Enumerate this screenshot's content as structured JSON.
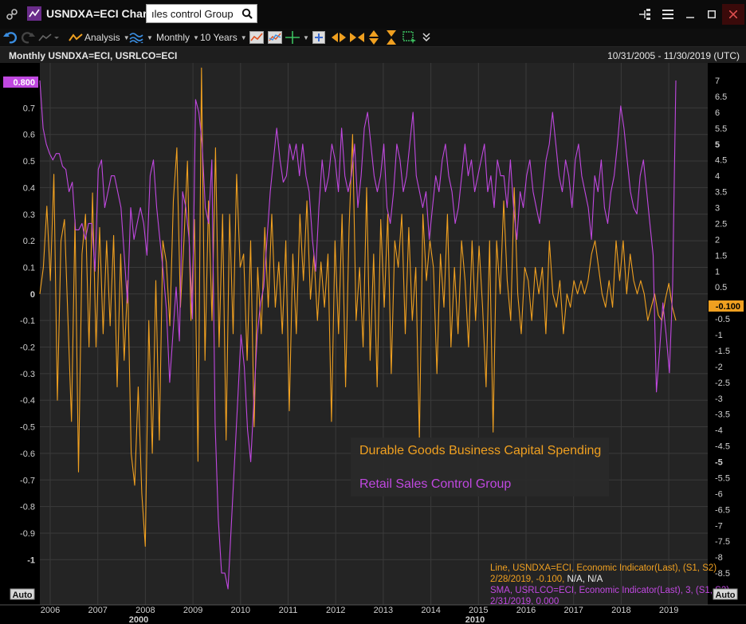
{
  "app": {
    "title": "USNDXA=ECI Chart",
    "search_value": "ıles control Group"
  },
  "toolbar": {
    "analysis_label": "Analysis",
    "interval_label": "Monthly",
    "range_label": "10 Years"
  },
  "chart_header": {
    "title": "Monthly USNDXA=ECI, USRLCO=ECI",
    "date_range": "10/31/2005 - 11/30/2019 (UTC)"
  },
  "colors": {
    "orange": "#f0a020",
    "purple": "#c048e0",
    "background": "#242424",
    "grid": "#3a3a3a",
    "axis_text": "#d0d0d0"
  },
  "chart_data": {
    "type": "line",
    "x_start": "2005-10",
    "x_end": "2019-02",
    "x_tick_labels": [
      "2006",
      "2007",
      "2008",
      "2009",
      "2010",
      "2011",
      "2012",
      "2013",
      "2014",
      "2015",
      "2016",
      "2017",
      "2018",
      "2019"
    ],
    "x_major_labels": [
      "2000",
      "2010"
    ],
    "left_axis": {
      "ylim": [
        -1.1,
        0.82
      ],
      "ticks": [
        0.7,
        0.6,
        0.5,
        0.4,
        0.3,
        0.2,
        0.1,
        0,
        -0.1,
        -0.2,
        -0.3,
        -0.4,
        -0.5,
        -0.6,
        -0.7,
        -0.8,
        -0.9,
        -1
      ],
      "tick_labels": [
        "0.7",
        "0.6",
        "0.5",
        "0.4",
        "0.3",
        "0.2",
        "0.1",
        "0",
        "-0.1",
        "-0.2",
        "-0.3",
        "-0.4",
        "-0.5",
        "-0.6",
        "-0.7",
        "-0.8",
        "-0.9",
        "-1"
      ],
      "last_value_label": "0.800",
      "auto_label": "Auto"
    },
    "right_axis": {
      "ylim": [
        -9.2,
        7.2
      ],
      "ticks": [
        7,
        6.5,
        6,
        5.5,
        5,
        4.5,
        4,
        3.5,
        3,
        2.5,
        2,
        1.5,
        1,
        0.5,
        -0.5,
        -1,
        -1.5,
        -2,
        -2.5,
        -3,
        -3.5,
        -4,
        -4.5,
        -5,
        -5.5,
        -6,
        -6.5,
        -7,
        -7.5,
        -8,
        -8.5
      ],
      "tick_labels": [
        "7",
        "6.5",
        "6",
        "5.5",
        "5",
        "4.5",
        "4",
        "3.5",
        "3",
        "2.5",
        "2",
        "1.5",
        "1",
        "0.5",
        "-0.5",
        "-1",
        "-1.5",
        "-2",
        "-2.5",
        "-3",
        "-3.5",
        "-4",
        "-4.5",
        "-5",
        "-5.5",
        "-6",
        "-6.5",
        "-7",
        "-7.5",
        "-8",
        "-8.5"
      ],
      "bold_ticks": [
        "5",
        "-5"
      ],
      "last_value_label": "-0.100",
      "auto_label": "Auto"
    },
    "series": [
      {
        "name": "Durable Goods Business Capital Spending",
        "axis": "left",
        "color": "#f0a020",
        "values": [
          0.0,
          0.1,
          0.33,
          0.05,
          0.45,
          -0.4,
          0.2,
          0.28,
          -0.1,
          -0.48,
          0.28,
          -0.67,
          0.15,
          0.3,
          -0.2,
          0.38,
          -0.2,
          0.25,
          -0.15,
          0.2,
          -0.12,
          0.22,
          -0.35,
          0.15,
          -0.25,
          0.05,
          -0.6,
          -0.72,
          -0.35,
          -0.75,
          -0.95,
          -0.1,
          -0.6,
          0.05,
          -0.55,
          0.2,
          0.12,
          -0.12,
          0.35,
          0.55,
          -0.05,
          0.2,
          0.5,
          -0.1,
          0.28,
          -0.63,
          0.85,
          -0.25,
          0.35,
          -0.1,
          0.55,
          -0.2,
          0.3,
          -0.55,
          0.3,
          -0.15,
          0.45,
          0.1,
          0.15,
          -0.25,
          0.2,
          -0.5,
          0.1,
          -0.15,
          0.25,
          -0.05,
          0.3,
          -0.05,
          0.12,
          -0.15,
          0.2,
          -0.44,
          0.15,
          -0.15,
          0.3,
          0.05,
          0.35,
          -0.02,
          0.15,
          -0.1,
          0.12,
          -0.05,
          0.15,
          -0.48,
          0.2,
          -0.15,
          0.3,
          -0.35,
          0.25,
          0.6,
          -0.1,
          0.1,
          -0.2,
          0.4,
          -0.25,
          0.15,
          -0.35,
          0.28,
          -0.05,
          0.3,
          -0.3,
          0.2,
          0.1,
          0.3,
          -0.15,
          0.25,
          -0.1,
          0.1,
          -0.55,
          0.3,
          0.05,
          0.2,
          0.1,
          -0.3,
          0.15,
          -0.05,
          0.3,
          -0.2,
          0.1,
          -0.15,
          0.2,
          0.05,
          -0.2,
          0.2,
          -0.1,
          0.18,
          -0.05,
          -0.35,
          0.2,
          -0.52,
          0.2,
          0.0,
          0.35,
          0.05,
          -0.1,
          0.4,
          0.0,
          -0.15,
          0.1,
          0.05,
          -0.1,
          0.1,
          0.0,
          0.1,
          -0.15,
          0.2,
          0.0,
          -0.05,
          0.05,
          -0.15,
          0.0,
          -0.05,
          0.05,
          0.0,
          0.05,
          0.0,
          0.05,
          0.15,
          0.2,
          0.1,
          0.0,
          -0.05,
          0.05,
          -0.05,
          0.2,
          0.05,
          0.2,
          0.0,
          0.15,
          0.05,
          0.0,
          0.05,
          0.0,
          -0.1,
          -0.05,
          0.0,
          -0.08,
          -0.1,
          -0.02,
          0.04,
          -0.05,
          -0.1
        ]
      },
      {
        "name": "Retail Sales Control Group",
        "axis": "right",
        "color": "#c048e0",
        "values": [
          7.0,
          5.5,
          5.0,
          4.7,
          4.5,
          4.7,
          4.7,
          4.3,
          4.2,
          3.5,
          3.8,
          2.3,
          2.3,
          2.5,
          2.0,
          2.5,
          2.5,
          1.0,
          4.2,
          4.5,
          3.0,
          3.5,
          4.0,
          4.0,
          3.5,
          3.0,
          1.5,
          0.0,
          3.0,
          2.0,
          2.5,
          3.0,
          2.5,
          1.5,
          4.0,
          4.5,
          3.0,
          2.0,
          1.0,
          -0.2,
          -2.5,
          -1.0,
          0.5,
          -1.2,
          3.5,
          3.0,
          2.0,
          -0.5,
          6.4,
          6.0,
          5.0,
          3.0,
          2.5,
          4.5,
          -3.8,
          -6.8,
          -8.5,
          -8.5,
          -9.0,
          -7.0,
          -5.0,
          -3.0,
          -1.0,
          -2.0,
          -4.0,
          -5.0,
          -3.0,
          -1.0,
          0.0,
          0.5,
          2.0,
          3.5,
          4.5,
          5.5,
          4.5,
          3.8,
          4.0,
          5.0,
          4.5,
          5.0,
          4.0,
          5.0,
          4.0,
          3.5,
          2.0,
          1.0,
          3.0,
          4.5,
          3.5,
          4.0,
          5.0,
          4.5,
          3.5,
          5.5,
          4.0,
          3.5,
          4.0,
          5.0,
          3.0,
          4.0,
          5.5,
          6.0,
          5.0,
          4.0,
          3.5,
          4.0,
          5.0,
          3.0,
          2.5,
          3.5,
          5.0,
          4.5,
          3.5,
          4.0,
          5.0,
          6.0,
          4.0,
          3.5,
          3.0,
          3.5,
          2.0,
          3.0,
          4.0,
          3.5,
          4.5,
          5.0,
          4.0,
          3.5,
          2.5,
          3.0,
          4.0,
          5.0,
          4.0,
          4.5,
          3.5,
          4.0,
          4.5,
          5.0,
          3.5,
          4.0,
          3.0,
          4.5,
          4.0,
          4.0,
          3.0,
          4.5,
          3.0,
          2.0,
          3.5,
          3.0,
          4.0,
          4.5,
          3.5,
          3.0,
          2.5,
          3.5,
          4.5,
          5.0,
          6.0,
          5.0,
          4.0,
          3.5,
          4.5,
          4.0,
          3.0,
          4.5,
          5.0,
          4.0,
          3.5,
          3.0,
          2.0,
          4.0,
          3.5,
          4.5,
          3.0,
          2.5,
          3.5,
          4.0,
          5.0,
          6.2,
          5.5,
          4.5,
          3.5,
          3.0,
          2.8,
          4.0,
          4.5,
          3.5,
          2.5,
          1.5,
          -2.8,
          -1.5,
          0.0,
          -1.0,
          -2.2,
          0.5,
          7.0
        ]
      }
    ],
    "legend": [
      "Durable Goods Business Capital Spending",
      "Retail Sales Control Group"
    ],
    "legend_placement": "bottom-center",
    "info_lines": [
      "Line, USNDXA=ECI, Economic Indicator(Last),  (S1, S2)",
      "2/28/2019, -0.100, N/A, N/A",
      "SMA, USRLCO=ECI, Economic Indicator(Last),  3, (S1, S2)",
      "2/31/2019, 0.000"
    ],
    "grid": true
  }
}
